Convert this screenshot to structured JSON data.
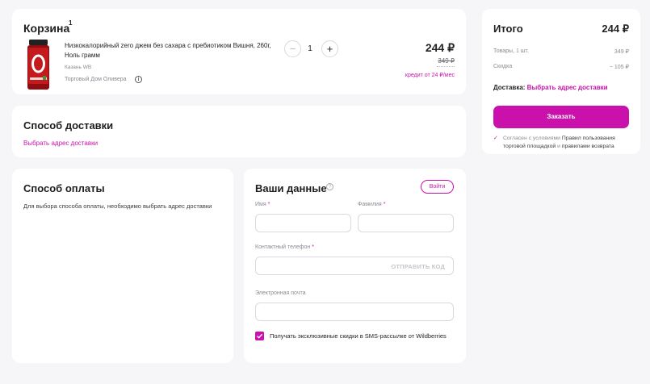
{
  "cart": {
    "title": "Корзина",
    "count": "1",
    "product": {
      "name": "Низкокалорийный zero джем без сахара с пребиотиком Вишня, 260г, Ноль грамм",
      "city": "Казань WB",
      "seller": "Торговый Дом Оливера",
      "quantity": "1",
      "price": "244 ₽",
      "old_price": "349 ₽",
      "credit": "кредит от 24 ₽/мес"
    }
  },
  "delivery": {
    "title": "Способ доставки",
    "link": "Выбрать адрес доставки"
  },
  "payment": {
    "title": "Способ оплаты",
    "note": "Для выбора способа оплаты, необходимо выбрать адрес доставки"
  },
  "user_data": {
    "title": "Ваши данные",
    "login": "Войти",
    "first_name_label": "Имя",
    "last_name_label": "Фамилия",
    "phone_label": "Контактный телефон",
    "send_code": "ОТПРАВИТЬ КОД",
    "email_label": "Электронная почта",
    "sms_consent": "Получать эксклюзивные скидки в SMS-рассылке от Wildberries",
    "sms_checked": true
  },
  "summary": {
    "title": "Итого",
    "total": "244 ₽",
    "goods_label": "Товары, 1 шт.",
    "goods_value": "349 ₽",
    "discount_label": "Скидка",
    "discount_value": "− 105 ₽",
    "delivery_label": "Доставка:",
    "delivery_link": "Выбрать адрес доставки",
    "order_button": "Заказать",
    "agree_prefix": "Согласен с условиями",
    "agree_rules": "Правил пользования торговой площадкой",
    "agree_and": "и",
    "agree_returns": "правилами возврата"
  },
  "colors": {
    "accent": "#cb11ab",
    "background": "#f6f6f9"
  },
  "icons": {
    "info": "info-icon",
    "help": "question-icon",
    "check": "checkmark-icon"
  }
}
